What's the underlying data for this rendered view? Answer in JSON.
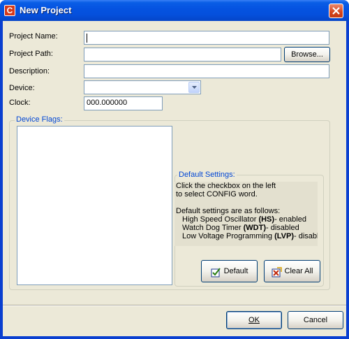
{
  "window": {
    "title": "New Project",
    "app_icon_letter": "C"
  },
  "form": {
    "project_name": {
      "label": "Project Name:",
      "value": ""
    },
    "project_path": {
      "label": "Project Path:",
      "value": ""
    },
    "browse_label": "Browse...",
    "description": {
      "label": "Description:",
      "value": ""
    },
    "device": {
      "label": "Device:",
      "value": ""
    },
    "clock": {
      "label": "Clock:",
      "value": "000.000000"
    }
  },
  "device_flags": {
    "legend": "Device Flags:",
    "items": []
  },
  "default_settings": {
    "legend": "Default Settings:",
    "line1": "Click the checkbox on the left",
    "line2": "to select CONFIG word.",
    "line3": "Default settings are as follows:",
    "items": [
      {
        "pre": "High Speed Oscillator ",
        "code": "(HS)",
        "post": "- enabled"
      },
      {
        "pre": "Watch Dog Timer ",
        "code": "(WDT)",
        "post": "- disabled"
      },
      {
        "pre": "Low Voltage Programming ",
        "code": "(LVP)",
        "post": "- disabled"
      }
    ],
    "default_button": "Default",
    "clear_all_button": "Clear All"
  },
  "footer": {
    "ok_label": "OK",
    "cancel_label": "Cancel"
  },
  "colors": {
    "titlebar": "#0553e1",
    "dialog_bg": "#ece9d8",
    "legend_text": "#0046d5",
    "close_button": "#d5431c"
  }
}
